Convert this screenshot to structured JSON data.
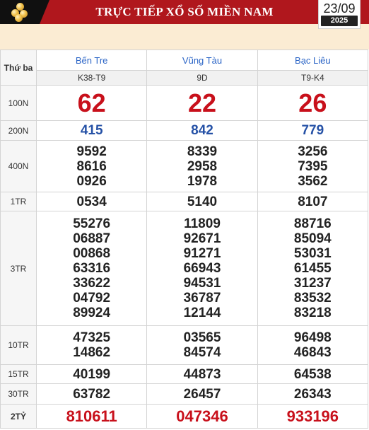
{
  "header": {
    "title": "TRỰC TIẾP XỔ SỐ MIỀN NAM",
    "day_month": "23/09",
    "year": "2025",
    "logo_icon": "lottery-balls-icon",
    "colors": {
      "bar": "#b0171d",
      "accent_red": "#c8101b",
      "blue": "#2551a6"
    }
  },
  "table": {
    "weekday": "Thứ ba",
    "provinces": [
      {
        "name": "Bến Tre",
        "code": "K38-T9"
      },
      {
        "name": "Vũng Tàu",
        "code": "9D"
      },
      {
        "name": "Bạc Liêu",
        "code": "T9-K4"
      }
    ],
    "prizes": [
      {
        "label": "100N",
        "style": "big",
        "values": [
          [
            "62"
          ],
          [
            "22"
          ],
          [
            "26"
          ]
        ]
      },
      {
        "label": "200N",
        "style": "blue",
        "values": [
          [
            "415"
          ],
          [
            "842"
          ],
          [
            "779"
          ]
        ]
      },
      {
        "label": "400N",
        "style": "num",
        "values": [
          [
            "9592",
            "8616",
            "0926"
          ],
          [
            "8339",
            "2958",
            "1978"
          ],
          [
            "3256",
            "7395",
            "3562"
          ]
        ]
      },
      {
        "label": "1TR",
        "style": "num",
        "values": [
          [
            "0534"
          ],
          [
            "5140"
          ],
          [
            "8107"
          ]
        ]
      },
      {
        "label": "3TR",
        "style": "num",
        "values": [
          [
            "55276",
            "06887",
            "00868",
            "63316",
            "33622",
            "04792",
            "89924"
          ],
          [
            "11809",
            "92671",
            "91271",
            "66943",
            "94531",
            "36787",
            "12144"
          ],
          [
            "88716",
            "85094",
            "53031",
            "61455",
            "31237",
            "83532",
            "83218"
          ]
        ]
      },
      {
        "label": "10TR",
        "style": "num",
        "values": [
          [
            "47325",
            "14862"
          ],
          [
            "03565",
            "84574"
          ],
          [
            "96498",
            "46843"
          ]
        ]
      },
      {
        "label": "15TR",
        "style": "num",
        "values": [
          [
            "40199"
          ],
          [
            "44873"
          ],
          [
            "64538"
          ]
        ]
      },
      {
        "label": "30TR",
        "style": "num",
        "values": [
          [
            "63782"
          ],
          [
            "26457"
          ],
          [
            "26343"
          ]
        ]
      },
      {
        "label": "2TỶ",
        "style": "jack",
        "values": [
          [
            "810611"
          ],
          [
            "047346"
          ],
          [
            "933196"
          ]
        ]
      }
    ]
  }
}
